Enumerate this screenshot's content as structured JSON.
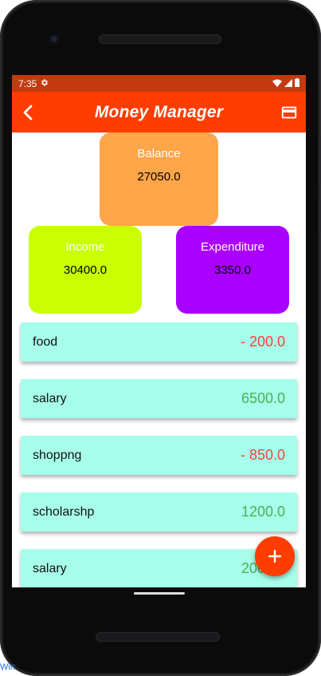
{
  "status_bar": {
    "time": "7:35"
  },
  "app_bar": {
    "title": "Money Manager"
  },
  "summary": {
    "balance": {
      "label": "Balance",
      "value": "27050.0"
    },
    "income": {
      "label": "Income",
      "value": "30400.0"
    },
    "expenditure": {
      "label": "Expenditure",
      "value": "3350.0"
    }
  },
  "transactions": [
    {
      "name": "food",
      "amount": "- 200.0",
      "type": "expense"
    },
    {
      "name": "salary",
      "amount": "6500.0",
      "type": "income"
    },
    {
      "name": "shoppng",
      "amount": "- 850.0",
      "type": "expense"
    },
    {
      "name": "scholarshp",
      "amount": "1200.0",
      "type": "income"
    },
    {
      "name": "salary",
      "amount": "2000.0",
      "type": "income"
    }
  ],
  "fab": {
    "icon": "plus-icon"
  },
  "colors": {
    "app_bar": "#ff3d00",
    "status_bar": "#c23a10",
    "balance": "#ffa54a",
    "income": "#c9ff00",
    "expenditure": "#aa00ff",
    "tx_row": "#a7ffeb",
    "expense_text": "#f44336",
    "income_text": "#4caf50"
  },
  "edge_text": "Win"
}
